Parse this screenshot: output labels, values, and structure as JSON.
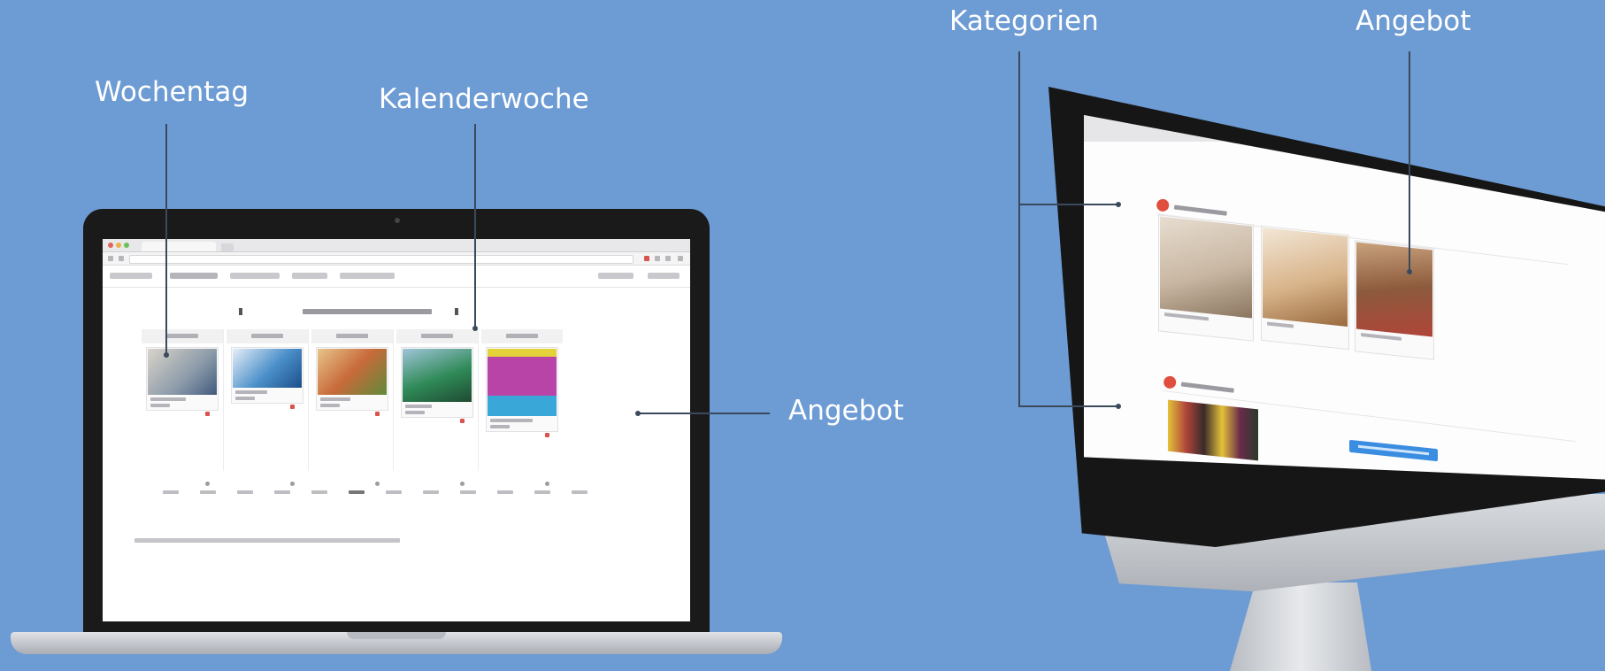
{
  "callouts": {
    "wochentag": "Wochentag",
    "kalenderwoche": "Kalenderwoche",
    "angebot_laptop": "Angebot",
    "kategorien": "Kategorien",
    "angebot_imac": "Angebot"
  },
  "colors": {
    "background": "#6d9bd3",
    "callout_text": "#ffffff",
    "leader_line": "#3a4a5c",
    "category_bullet": "#e04f3e",
    "action_button": "#3a8de0"
  },
  "laptop_screen": {
    "day_columns": [
      {
        "thumb_color": "#8b9aa9"
      },
      {
        "thumb_color": "#4a8fc9"
      },
      {
        "thumb_color": "#c86a3a"
      },
      {
        "thumb_color": "#2f8a57"
      },
      {
        "thumb_color": "#b844a8"
      }
    ]
  },
  "imac_screen": {
    "categories": [
      {
        "icon": "coffee-icon"
      },
      {
        "icon": "wine-icon"
      }
    ],
    "offer_photos": [
      {
        "color": "#c9b7a3"
      },
      {
        "color": "#d8b48a"
      },
      {
        "color": "#8c5a3c"
      },
      {
        "color": "#b0453a"
      }
    ]
  }
}
